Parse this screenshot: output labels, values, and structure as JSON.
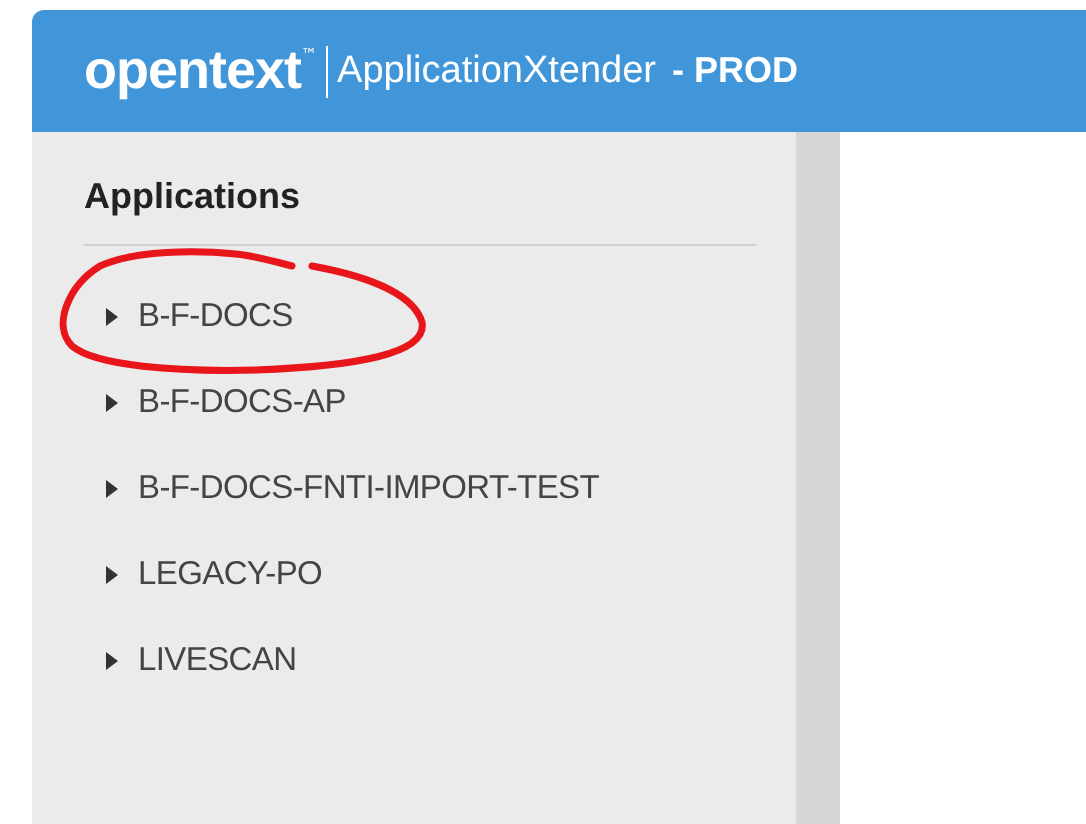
{
  "header": {
    "logo": "opentext",
    "trademark": "™",
    "product": "ApplicationXtender",
    "environment": "- PROD"
  },
  "sidebar": {
    "title": "Applications",
    "items": [
      {
        "label": "B-F-DOCS",
        "circled": true
      },
      {
        "label": "B-F-DOCS-AP",
        "circled": false
      },
      {
        "label": "B-F-DOCS-FNTI-IMPORT-TEST",
        "circled": false
      },
      {
        "label": "LEGACY-PO",
        "circled": false
      },
      {
        "label": "LIVESCAN",
        "circled": false
      }
    ]
  }
}
